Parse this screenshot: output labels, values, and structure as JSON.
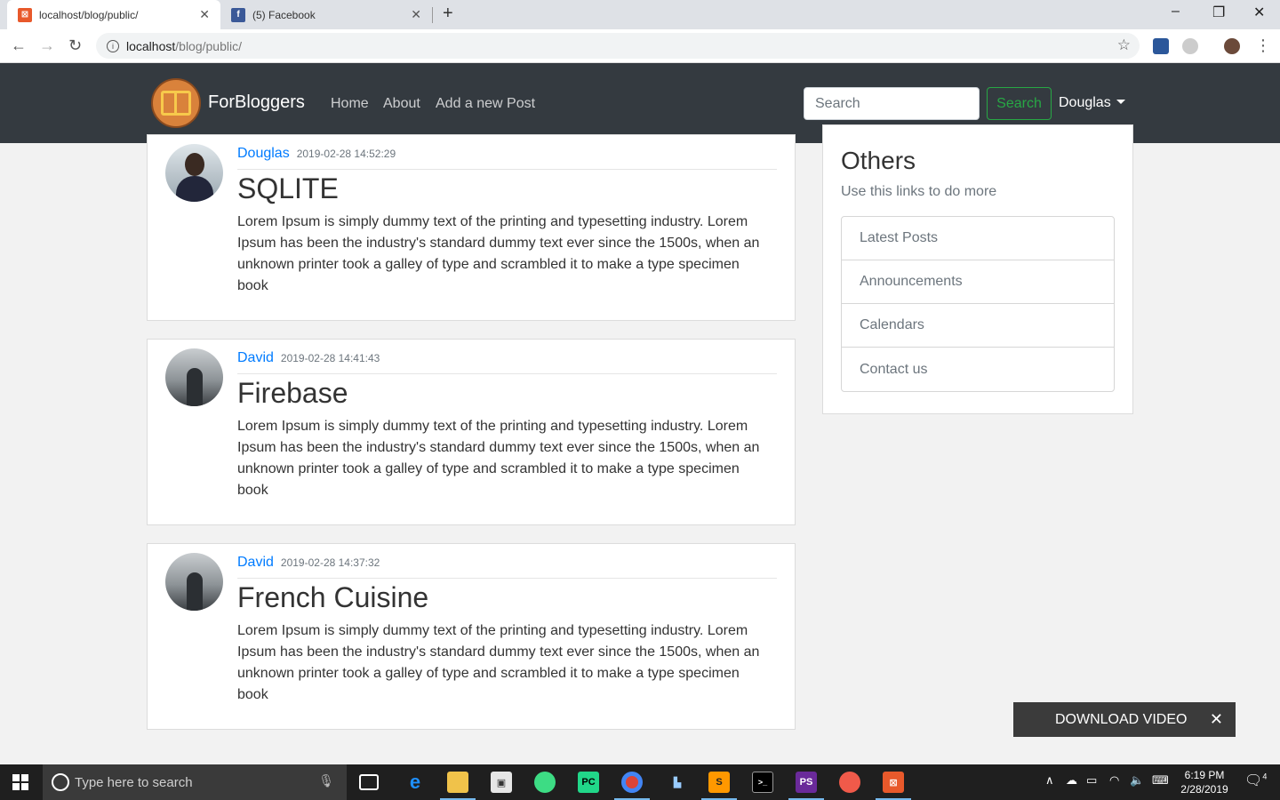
{
  "browser": {
    "tabs": [
      {
        "title": "localhost/blog/public/",
        "active": true
      },
      {
        "title": "(5) Facebook",
        "active": false
      }
    ],
    "url_host": "localhost",
    "url_path": "/blog/public/"
  },
  "navbar": {
    "brand": "ForBloggers",
    "links": [
      "Home",
      "About",
      "Add a new Post"
    ],
    "search_placeholder": "Search",
    "search_button": "Search",
    "user": "Douglas"
  },
  "posts": [
    {
      "author": "Douglas",
      "date": "2019-02-28 14:52:29",
      "title": "SQLITE",
      "excerpt": "Lorem Ipsum is simply dummy text of the printing and typesetting industry. Lorem Ipsum has been the industry's standard dummy text ever since the 1500s, when an unknown printer took a galley of type and scrambled it to make a type specimen book"
    },
    {
      "author": "David",
      "date": "2019-02-28 14:41:43",
      "title": "Firebase",
      "excerpt": "Lorem Ipsum is simply dummy text of the printing and typesetting industry. Lorem Ipsum has been the industry's standard dummy text ever since the 1500s, when an unknown printer took a galley of type and scrambled it to make a type specimen book"
    },
    {
      "author": "David",
      "date": "2019-02-28 14:37:32",
      "title": "French Cuisine",
      "excerpt": "Lorem Ipsum is simply dummy text of the printing and typesetting industry. Lorem Ipsum has been the industry's standard dummy text ever since the 1500s, when an unknown printer took a galley of type and scrambled it to make a type specimen book"
    }
  ],
  "sidebar": {
    "title": "Others",
    "subtitle": "Use this links to do more",
    "items": [
      "Latest Posts",
      "Announcements",
      "Calendars",
      "Contact us"
    ]
  },
  "overlay": {
    "download_label": "DOWNLOAD VIDEO"
  },
  "taskbar": {
    "search_placeholder": "Type here to search",
    "time": "6:19 PM",
    "date": "2/28/2019",
    "notification_count": "4"
  },
  "colors": {
    "navbar_bg": "#343a40",
    "link_blue": "#007bff",
    "success_green": "#28a745"
  }
}
